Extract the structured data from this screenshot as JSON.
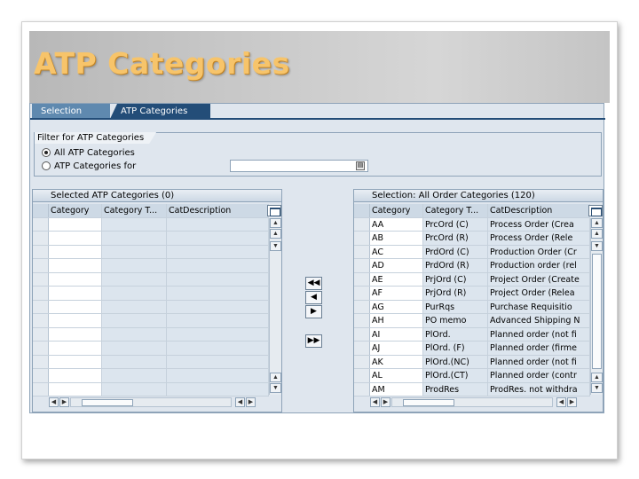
{
  "slide": {
    "title": "ATP Categories"
  },
  "tabs": [
    {
      "label": "Selection",
      "active": false
    },
    {
      "label": "ATP Categories",
      "active": true
    }
  ],
  "filter": {
    "title": "Filter for ATP Categories",
    "options": [
      {
        "label": "All ATP Categories",
        "selected": true
      },
      {
        "label": "ATP Categories for",
        "selected": false
      }
    ],
    "input_value": ""
  },
  "left_panel": {
    "title": "Selected ATP Categories (0)",
    "columns": [
      "Category",
      "Category T...",
      "CatDescription"
    ],
    "rows": []
  },
  "right_panel": {
    "title": "Selection: All Order Categories (120)",
    "columns": [
      "Category",
      "Category T...",
      "CatDescription"
    ],
    "rows": [
      [
        "AA",
        "PrcOrd (C)",
        "Process Order (Crea"
      ],
      [
        "AB",
        "PrcOrd (R)",
        "Process Order (Rele"
      ],
      [
        "AC",
        "PrdOrd (C)",
        "Production Order (Cr"
      ],
      [
        "AD",
        "PrdOrd (R)",
        "Production order (rel"
      ],
      [
        "AE",
        "PrjOrd (C)",
        "Project Order (Create"
      ],
      [
        "AF",
        "PrjOrd (R)",
        "Project Order (Relea"
      ],
      [
        "AG",
        "PurRqs",
        "Purchase Requisitio"
      ],
      [
        "AH",
        "PO memo",
        "Advanced Shipping N"
      ],
      [
        "AI",
        "PlOrd.",
        "Planned order (not fi"
      ],
      [
        "AJ",
        "PlOrd. (F)",
        "Planned order (firme"
      ],
      [
        "AK",
        "PlOrd.(NC)",
        "Planned order (not fi"
      ],
      [
        "AL",
        "PlOrd.(CT)",
        "Planned order (contr"
      ],
      [
        "AM",
        "ProdRes",
        "ProdRes. not withdra"
      ]
    ]
  },
  "move_buttons": [
    {
      "name": "move-all-left-button",
      "glyph": "◀◀"
    },
    {
      "name": "move-left-button",
      "glyph": "◀"
    },
    {
      "name": "move-right-button",
      "glyph": "▶"
    },
    {
      "name": "move-all-right-button",
      "glyph": "▶▶"
    }
  ],
  "icons": {
    "scroll_up": "▲",
    "scroll_down": "▼",
    "scroll_left": "◀",
    "scroll_right": "▶",
    "first": "▲",
    "last": "▼"
  }
}
